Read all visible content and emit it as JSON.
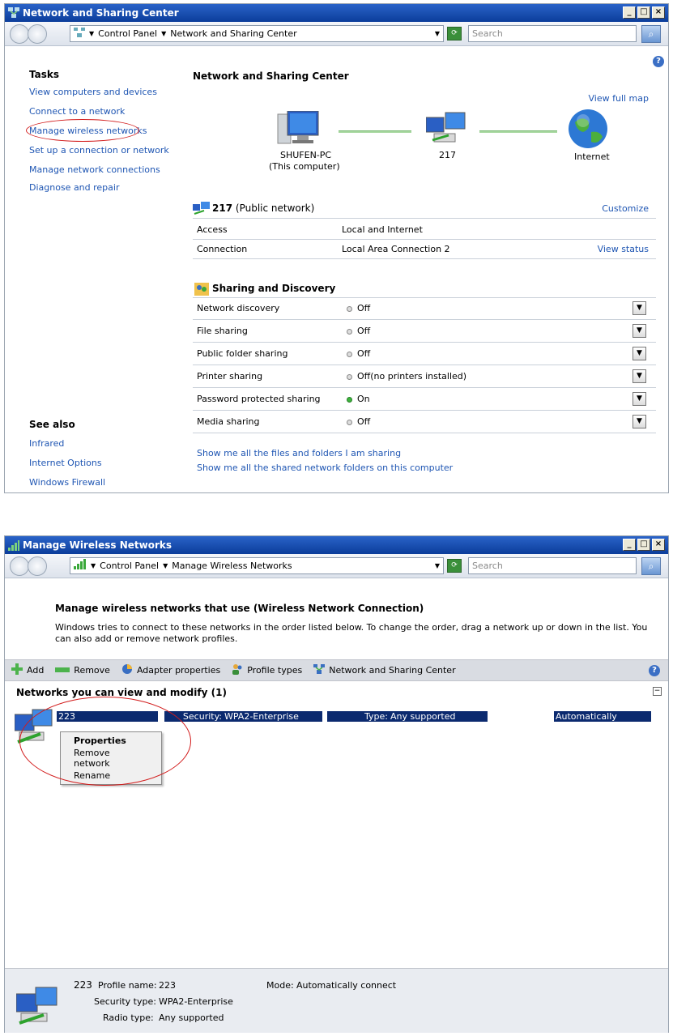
{
  "win1": {
    "title": "Network and Sharing Center",
    "crumb_root": "Control Panel",
    "crumb_current": "Network and Sharing Center",
    "search_placeholder": "Search",
    "tasks_heading": "Tasks",
    "tasks": [
      "View computers and devices",
      "Connect to a network",
      "Manage wireless networks",
      "Set up a connection or network",
      "Manage network connections",
      "Diagnose and repair"
    ],
    "see_also_heading": "See also",
    "see_also": [
      "Infrared",
      "Internet Options",
      "Windows Firewall"
    ],
    "main_title": "Network and Sharing Center",
    "view_full_map": "View full map",
    "map": {
      "computer_name": "SHUFEN-PC",
      "computer_sub": "(This computer)",
      "network_name": "217",
      "internet": "Internet"
    },
    "network": {
      "name": "217",
      "type": "(Public network)",
      "customize": "Customize",
      "access_label": "Access",
      "access_value": "Local and Internet",
      "connection_label": "Connection",
      "connection_value": "Local Area Connection 2",
      "view_status": "View status"
    },
    "sharing": {
      "heading": "Sharing and Discovery",
      "rows": [
        {
          "label": "Network discovery",
          "value": "Off",
          "on": false
        },
        {
          "label": "File sharing",
          "value": "Off",
          "on": false
        },
        {
          "label": "Public folder sharing",
          "value": "Off",
          "on": false
        },
        {
          "label": "Printer sharing",
          "value": "Off(no printers installed)",
          "on": false
        },
        {
          "label": "Password protected sharing",
          "value": "On",
          "on": true
        },
        {
          "label": "Media sharing",
          "value": "Off",
          "on": false
        }
      ],
      "link1": "Show me all the files and folders I am sharing",
      "link2": "Show me all the shared network folders on this computer"
    }
  },
  "win2": {
    "title": "Manage Wireless Networks",
    "crumb_root": "Control Panel",
    "crumb_current": "Manage Wireless Networks",
    "search_placeholder": "Search",
    "heading": "Manage wireless networks that use (Wireless Network Connection)",
    "description": "Windows tries to connect to these networks in the order listed below. To change the order, drag a network up or down in the list. You can also add or remove network profiles.",
    "toolbar": {
      "add": "Add",
      "remove": "Remove",
      "adapter": "Adapter properties",
      "profile_types": "Profile types",
      "nsc": "Network and Sharing Center"
    },
    "list_heading": "Networks you can view and modify (1)",
    "network": {
      "name": "223",
      "security_label": "Security:",
      "security": "WPA2-Enterprise",
      "type_label": "Type:",
      "type": "Any supported",
      "mode": "Automatically connect"
    },
    "context_menu": [
      "Properties",
      "Remove network",
      "Rename"
    ],
    "details": {
      "name": "223",
      "profile_label": "Profile name:",
      "profile": "223",
      "mode_label": "Mode:",
      "mode": "Automatically connect",
      "security_label": "Security type:",
      "security": "WPA2-Enterprise",
      "radio_label": "Radio type:",
      "radio": "Any supported"
    }
  },
  "colors": {
    "link": "#1f56b3",
    "titlebar": "#0b3d9b",
    "highlight": "#0b2a6f",
    "annotation_red": "#d21c1c",
    "status_on": "#3db43d"
  }
}
